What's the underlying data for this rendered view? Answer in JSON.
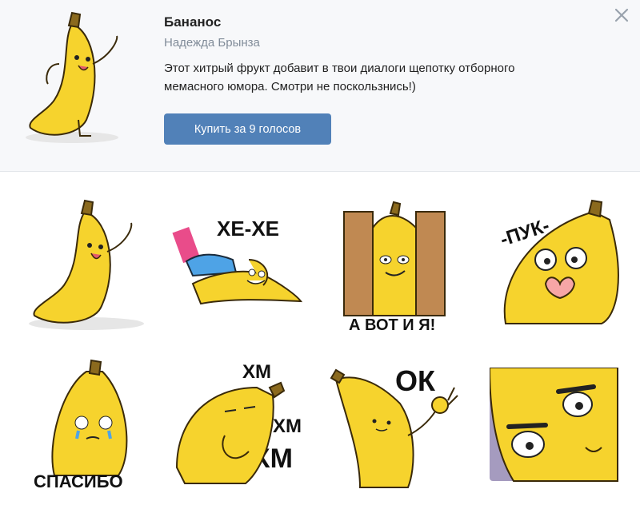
{
  "pack": {
    "title": "Бананос",
    "author": "Надежда Брынза",
    "description_line1": "Этот хитрый фрукт добавит в твои диалоги щепотку отборного",
    "description_line2": "мемасного юмора. Смотри не поскользнись!)",
    "buy_label": "Купить за 9 голосов"
  },
  "colors": {
    "accent": "#5181b8",
    "banana": "#f6d32d",
    "banana_shade": "#e1b619",
    "stem": "#8b6a1e",
    "header_bg": "#f7f8fa"
  },
  "icons": {
    "close": "close-icon"
  },
  "stickers": [
    {
      "name": "banana-waving",
      "caption": ""
    },
    {
      "name": "banana-sneaker",
      "caption": "ХЕ-ХЕ"
    },
    {
      "name": "banana-fence",
      "caption": "А ВОТ И Я!"
    },
    {
      "name": "banana-heart",
      "caption": "-ПУК-"
    },
    {
      "name": "banana-crying",
      "caption": "СПАСИБО"
    },
    {
      "name": "banana-thinking",
      "caption_1": "ХМ",
      "caption_2": "ХМ",
      "caption_3": "ХМ"
    },
    {
      "name": "banana-ok",
      "caption": "ОК"
    },
    {
      "name": "banana-closeup",
      "caption": ""
    }
  ]
}
